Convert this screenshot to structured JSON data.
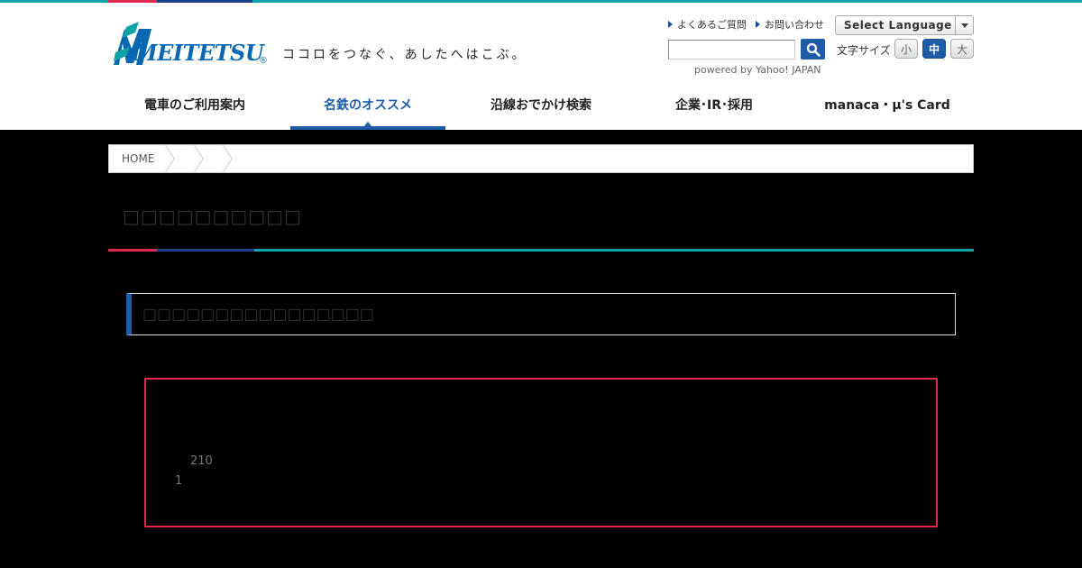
{
  "brand": {
    "logo_text": "MEITETSU",
    "registered_mark": "®",
    "tagline": "ココロをつなぐ、あしたへはこぶ。",
    "colors": {
      "primary_blue": "#1e5ca8",
      "teal": "#0ea3a8",
      "red": "#e0294f",
      "navy": "#1e3f8f"
    }
  },
  "header": {
    "links": [
      {
        "label": "よくあるご質問"
      },
      {
        "label": "お問い合わせ"
      }
    ],
    "language_select": {
      "selected": "Select Language"
    },
    "search": {
      "value": "",
      "placeholder": "",
      "button_icon": "search-icon",
      "powered_by": "powered by Yahoo! JAPAN"
    },
    "font_size": {
      "label": "文字サイズ",
      "options": [
        "小",
        "中",
        "大"
      ],
      "active": "中"
    }
  },
  "global_nav": {
    "items": [
      {
        "label": "電車のご利用案内"
      },
      {
        "label": "名鉄のオススメ"
      },
      {
        "label": "沿線おでかけ検索"
      },
      {
        "label": "企業･IR･採用"
      },
      {
        "label": "manaca・μ's Card"
      }
    ],
    "active_index": 1
  },
  "breadcrumb": {
    "items": [
      "HOME",
      "",
      "",
      ""
    ]
  },
  "page": {
    "title": "□□□□□□□□□□",
    "section_heading": "□□□□□□□□□□□□□□□□",
    "content_numbers": [
      "210",
      "1"
    ]
  }
}
